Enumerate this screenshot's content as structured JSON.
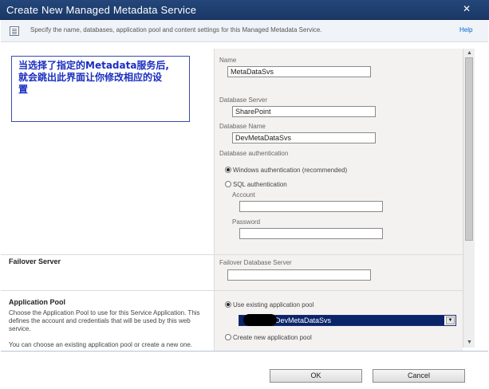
{
  "window": {
    "title": "Create New Managed Metadata Service"
  },
  "info_bar": {
    "description": "Specify the name, databases, application pool and content settings for this Managed Metadata Service.",
    "help_label": "Help"
  },
  "callout": {
    "lines": [
      "当选择了指定的Metadata服务后,",
      "就会跳出此界面让你修改相应的设",
      "置"
    ]
  },
  "form": {
    "name_label": "Name",
    "name_value": "MetaDataSvs",
    "db_server_label": "Database Server",
    "db_server_value": "SharePoint",
    "db_name_label": "Database Name",
    "db_name_value": "DevMetaDataSvs",
    "db_auth_label": "Database authentication",
    "auth_options": [
      {
        "label": "Windows authentication (recommended)",
        "selected": true
      },
      {
        "label": "SQL authentication",
        "selected": false
      }
    ],
    "account_label": "Account",
    "account_value": "",
    "password_label": "Password",
    "password_value": ""
  },
  "failover": {
    "section_title": "Failover Server",
    "field_label": "Failover Database Server",
    "field_value": ""
  },
  "app_pool": {
    "section_title": "Application Pool",
    "description": "Choose the Application Pool to use for this Service Application. This defines the account and credentials that will be used by this web service.",
    "description_2": "You can choose an existing application pool or create a new one.",
    "options": [
      {
        "label": "Use existing application pool",
        "selected": true
      },
      {
        "label": "Create new application pool",
        "selected": false
      }
    ],
    "selected_pool": "DevMetaDataSvs"
  },
  "buttons": {
    "ok_label": "OK",
    "cancel_label": "Cancel"
  },
  "colors": {
    "title_bar": "#1a3866",
    "selection": "#0a246a",
    "callout_text": "#1a2ec0",
    "link": "#0066cc"
  }
}
